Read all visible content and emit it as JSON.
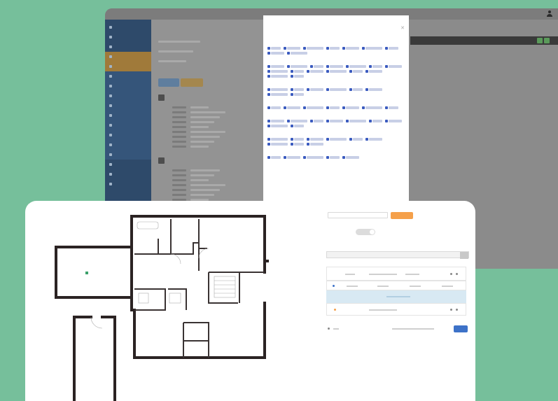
{
  "colors": {
    "background": "#76bf9b",
    "sidebar": "#2e4a6a",
    "sidebar_active": "#a07a3a",
    "modal_tag_checkbox": "#3b5bbf",
    "orange_button": "#f5a04a",
    "blue_button": "#3d72c8",
    "wall": "#2b2323"
  },
  "icons": {
    "user": "user-icon",
    "close": "close-icon",
    "tag_checkbox": "checkbox-checked-icon",
    "toggle": "toggle-switch-icon",
    "dropdown": "chevron-down-icon"
  },
  "back_window": {
    "sidebar_items": [
      {
        "label": "",
        "state": "normal"
      },
      {
        "label": "",
        "state": "normal"
      },
      {
        "label": "",
        "state": "normal"
      },
      {
        "label": "",
        "state": "active"
      },
      {
        "label": "",
        "state": "active"
      },
      {
        "label": "",
        "state": "sub"
      },
      {
        "label": "",
        "state": "sub"
      },
      {
        "label": "",
        "state": "sub"
      },
      {
        "label": "",
        "state": "sub"
      },
      {
        "label": "",
        "state": "sub"
      },
      {
        "label": "",
        "state": "sub"
      },
      {
        "label": "",
        "state": "sub"
      },
      {
        "label": "",
        "state": "sub"
      },
      {
        "label": "",
        "state": "sub"
      },
      {
        "label": "",
        "state": "normal"
      },
      {
        "label": "",
        "state": "normal"
      },
      {
        "label": "",
        "state": "normal"
      }
    ]
  },
  "modal": {
    "tag_groups": [
      {
        "tags": [
          "",
          "",
          "",
          "",
          "",
          "",
          "",
          "",
          ""
        ]
      },
      {
        "tags": [
          "",
          "",
          "",
          "",
          "",
          "",
          "",
          "",
          "",
          "",
          "",
          "",
          "",
          "",
          ""
        ]
      },
      {
        "tags": [
          "",
          "",
          "",
          "",
          "",
          "",
          "",
          ""
        ]
      },
      {
        "tags": [
          "",
          "",
          "",
          "",
          "",
          "",
          ""
        ]
      },
      {
        "tags": [
          "",
          "",
          "",
          "",
          "",
          "",
          "",
          "",
          ""
        ]
      },
      {
        "tags": [
          "",
          "",
          "",
          "",
          "",
          "",
          "",
          "",
          ""
        ]
      },
      {
        "tags": [
          "",
          "",
          "",
          "",
          ""
        ]
      }
    ]
  },
  "front_card": {
    "form": {
      "submit_button": "",
      "toggle_on": false,
      "selected": "",
      "action_button": ""
    }
  }
}
